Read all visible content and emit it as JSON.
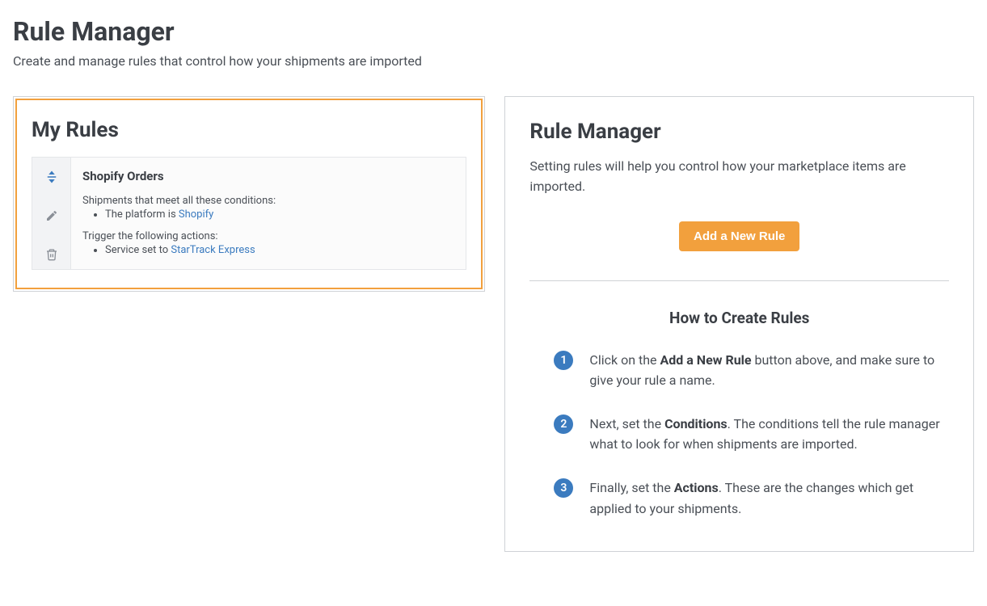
{
  "header": {
    "title": "Rule Manager",
    "subtitle": "Create and manage rules that control how your shipments are imported"
  },
  "left": {
    "title": "My Rules",
    "rule": {
      "name": "Shopify Orders",
      "conditions_label": "Shipments that meet all these conditions:",
      "condition_prefix": "The platform is ",
      "condition_link": "Shopify",
      "actions_label": "Trigger the following actions:",
      "action_prefix": "Service set to ",
      "action_link": "StarTrack Express"
    }
  },
  "right": {
    "title": "Rule Manager",
    "description": "Setting rules will help you control how your marketplace items are imported.",
    "button_label": "Add a New Rule",
    "how_title": "How to Create Rules",
    "steps": [
      {
        "num": "1",
        "pre": "Click on the ",
        "bold": "Add a New Rule",
        "post": " button above, and make sure to give your rule a name."
      },
      {
        "num": "2",
        "pre": "Next, set the ",
        "bold": "Conditions",
        "post": ". The conditions tell the rule manager what to look for when shipments are imported."
      },
      {
        "num": "3",
        "pre": "Finally, set the ",
        "bold": "Actions",
        "post": ". These are the changes which get applied to your shipments."
      }
    ]
  }
}
